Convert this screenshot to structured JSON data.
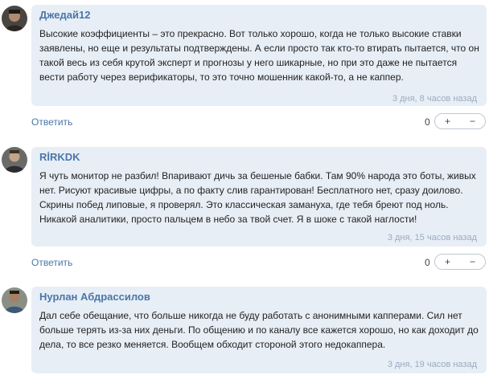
{
  "comments": [
    {
      "author": "Джедай12",
      "text": "Высокие коэффициенты – это прекрасно. Вот только хорошо, когда не только высокие ставки заявлены, но еще и результаты подтверждены. А если просто так кто-то втирать пытается, что он такой весь из себя крутой эксперт и прогнозы у него шикарные, но при это даже не пытается вести работу через верификаторы, то это точно мошенник какой-то, а не каппер.",
      "time": "3 дня, 8 часов назад",
      "reply_label": "Ответить",
      "votes": "0",
      "plus_label": "+",
      "minus_label": "−"
    },
    {
      "author": "RİRKDK",
      "text": "Я чуть монитор не разбил! Впаривают дичь за бешеные бабки. Там 90% народа это боты, живых нет. Рисуют красивые цифры, а по факту слив гарантирован! Бесплатного нет, сразу доилово. Скрины побед липовые, я проверял. Это классическая замануха, где тебя бреют под ноль. Никакой аналитики, просто пальцем в небо за твой счет. Я в шоке с такой наглости!",
      "time": "3 дня, 15 часов назад",
      "reply_label": "Ответить",
      "votes": "0",
      "plus_label": "+",
      "minus_label": "−"
    },
    {
      "author": "Нурлан Абдрассилов",
      "text": "Дал себе обещание, что больше никогда не буду работать с анонимными капперами. Сил нет больше терять из-за них деньги. По общению и по каналу все кажется хорошо, но как доходит до дела, то все резко меняется. Вообщем обходит стороной этого недокаппера.",
      "time": "3 дня, 19 часов назад"
    }
  ]
}
